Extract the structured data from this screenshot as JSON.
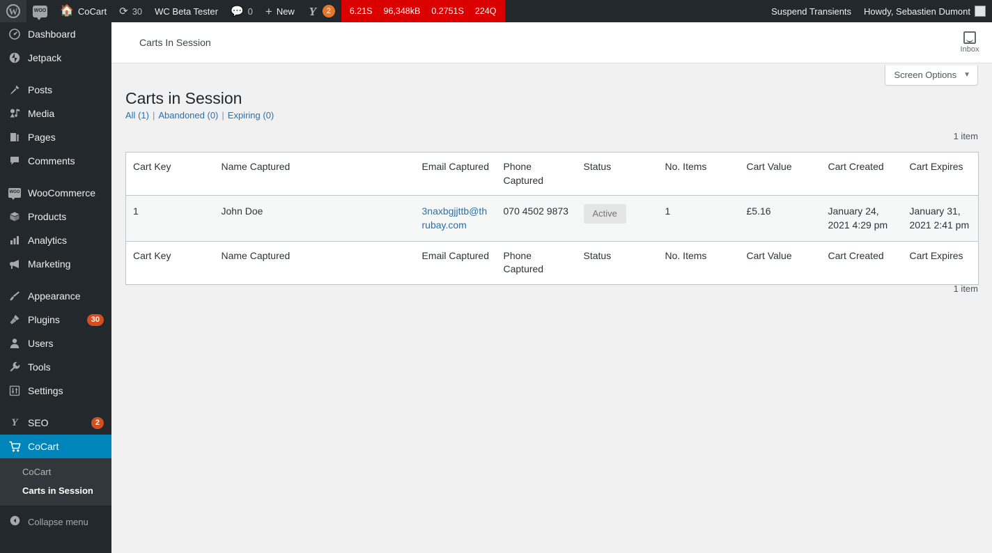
{
  "adminbar": {
    "left_items": [
      {
        "name": "wordpress-logo",
        "icon": "wordpress-icon",
        "label": ""
      },
      {
        "name": "woocommerce-logo",
        "icon": "woocommerce-icon",
        "label": ""
      },
      {
        "name": "site-name",
        "icon": "home-icon",
        "label": "CoCart"
      },
      {
        "name": "updates",
        "icon": "refresh-icon",
        "label": "30"
      },
      {
        "name": "wc-beta-tester",
        "icon": "",
        "label": "WC Beta Tester"
      },
      {
        "name": "comments",
        "icon": "comment-icon",
        "label": "0"
      },
      {
        "name": "new-content",
        "icon": "plus-icon",
        "label": "New"
      },
      {
        "name": "yoast-seo",
        "icon": "yoast-icon",
        "label": "",
        "bubble": "2"
      }
    ],
    "query_monitor": {
      "time": "6.21S",
      "memory": "96,348kB",
      "db_time": "0.2751S",
      "queries": "224Q",
      "color": "#da0000"
    },
    "suspend_transients": "Suspend Transients",
    "howdy": "Howdy, Sebastien Dumont"
  },
  "sidebar": {
    "items": [
      {
        "label": "Dashboard",
        "icon": "dashboard-icon",
        "glyph": "⊙",
        "name": "sidebar-item-dashboard"
      },
      {
        "label": "Jetpack",
        "icon": "jetpack-icon",
        "glyph": "◑",
        "name": "sidebar-item-jetpack"
      },
      {
        "label": "Posts",
        "icon": "pin-icon",
        "glyph": "✎",
        "name": "sidebar-item-posts",
        "gap_before": true
      },
      {
        "label": "Media",
        "icon": "media-icon",
        "glyph": "♬",
        "name": "sidebar-item-media"
      },
      {
        "label": "Pages",
        "icon": "pages-icon",
        "glyph": "▣",
        "name": "sidebar-item-pages"
      },
      {
        "label": "Comments",
        "icon": "comment-icon",
        "glyph": "💬",
        "name": "sidebar-item-comments"
      },
      {
        "label": "WooCommerce",
        "icon": "woocommerce-icon",
        "glyph": "woo",
        "name": "sidebar-item-woocommerce",
        "gap_before": true
      },
      {
        "label": "Products",
        "icon": "products-icon",
        "glyph": "◧",
        "name": "sidebar-item-products"
      },
      {
        "label": "Analytics",
        "icon": "analytics-icon",
        "glyph": "▮",
        "name": "sidebar-item-analytics"
      },
      {
        "label": "Marketing",
        "icon": "megaphone-icon",
        "glyph": "📣",
        "name": "sidebar-item-marketing"
      },
      {
        "label": "Appearance",
        "icon": "brush-icon",
        "glyph": "✑",
        "name": "sidebar-item-appearance",
        "gap_before": true
      },
      {
        "label": "Plugins",
        "icon": "plug-icon",
        "glyph": "⚿",
        "name": "sidebar-item-plugins",
        "bubble": "30"
      },
      {
        "label": "Users",
        "icon": "user-icon",
        "glyph": "👤",
        "name": "sidebar-item-users"
      },
      {
        "label": "Tools",
        "icon": "wrench-icon",
        "glyph": "🔧",
        "name": "sidebar-item-tools"
      },
      {
        "label": "Settings",
        "icon": "settings-icon",
        "glyph": "⇅",
        "name": "sidebar-item-settings"
      },
      {
        "label": "SEO",
        "icon": "yoast-icon",
        "glyph": "yoast",
        "name": "sidebar-item-seo",
        "bubble": "2",
        "gap_before": true
      },
      {
        "label": "CoCart",
        "icon": "cart-icon",
        "glyph": "🛒",
        "name": "sidebar-item-cocart",
        "current": true
      }
    ],
    "submenu": [
      {
        "label": "CoCart",
        "name": "submenu-item-cocart",
        "current": false
      },
      {
        "label": "Carts in Session",
        "name": "submenu-item-carts-in-session",
        "current": true
      }
    ],
    "collapse_label": "Collapse menu",
    "current_color": "#0085ba"
  },
  "woo_header": {
    "title": "Carts In Session",
    "inbox_label": "Inbox"
  },
  "screen_meta": {
    "screen_options_label": "Screen Options",
    "caret": "▼"
  },
  "main": {
    "page_title": "Carts in Session",
    "views": [
      {
        "label": "All",
        "count": "(1)",
        "name": "view-all"
      },
      {
        "label": "Abandoned",
        "count": "(0)",
        "name": "view-abandoned"
      },
      {
        "label": "Expiring",
        "count": "(0)",
        "name": "view-expiring"
      }
    ],
    "view_separator": "|",
    "count_top": "1 item",
    "count_bottom": "1 item",
    "table": {
      "columns": [
        {
          "label": "Cart Key",
          "key": "cart_key",
          "cls": "col-cartkey"
        },
        {
          "label": "Name Captured",
          "key": "name_captured",
          "cls": "col-name"
        },
        {
          "label": "Email Captured",
          "key": "email_captured",
          "cls": "col-email"
        },
        {
          "label": "Phone Captured",
          "key": "phone_captured",
          "cls": "col-phone"
        },
        {
          "label": "Status",
          "key": "status",
          "cls": "col-status"
        },
        {
          "label": "No. Items",
          "key": "no_items",
          "cls": "col-items"
        },
        {
          "label": "Cart Value",
          "key": "cart_value",
          "cls": "col-value"
        },
        {
          "label": "Cart Created",
          "key": "cart_created",
          "cls": "col-created"
        },
        {
          "label": "Cart Expires",
          "key": "cart_expires",
          "cls": "col-expires"
        }
      ],
      "rows": [
        {
          "cart_key": "1",
          "name_captured": "John Doe",
          "email_captured": "3naxbgjjttb@thrubay.com",
          "phone_captured": "070 4502 9873",
          "status": "Active",
          "no_items": "1",
          "cart_value": "£5.16",
          "cart_created": "January 24, 2021 4:29 pm",
          "cart_expires": "January 31, 2021 2:41 pm"
        }
      ]
    }
  },
  "colors": {
    "admin_bar": "#23282d",
    "sidebar": "#23282d",
    "submenu": "#32373c",
    "content_bg": "#f1f1f1",
    "link": "#2271b1",
    "accent": "#0085ba",
    "badge_bg": "#e5e5e5"
  }
}
